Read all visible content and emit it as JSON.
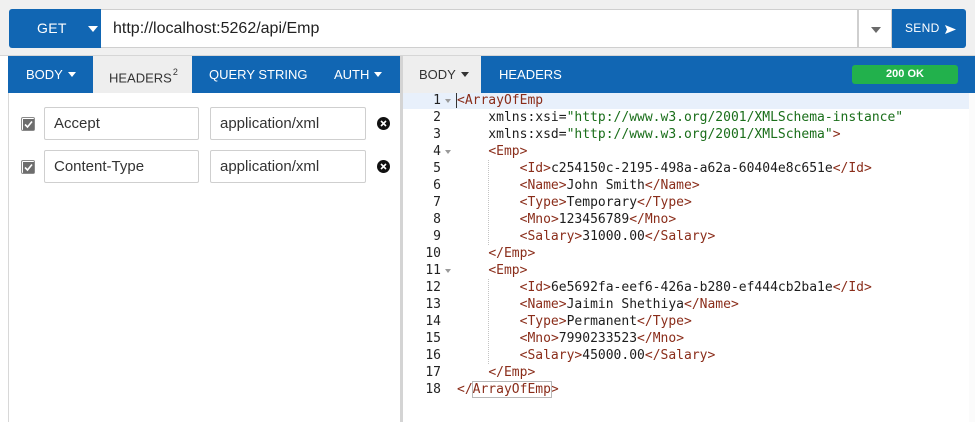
{
  "request": {
    "method": "GET",
    "url": "http://localhost:5262/api/Emp",
    "send_label": "SEND"
  },
  "request_tabs": [
    {
      "label": "BODY",
      "has_caret": true
    },
    {
      "label": "HEADERS",
      "badge": "2"
    },
    {
      "label": "QUERY STRING"
    },
    {
      "label": "AUTH",
      "has_caret": true
    }
  ],
  "headers": [
    {
      "enabled": true,
      "key": "Accept",
      "value": "application/xml"
    },
    {
      "enabled": true,
      "key": "Content-Type",
      "value": "application/xml"
    }
  ],
  "response_tabs": [
    {
      "label": "BODY",
      "has_caret": true
    },
    {
      "label": "HEADERS"
    }
  ],
  "response": {
    "status": "200 OK",
    "status_color": "#22b14c",
    "lines": [
      {
        "n": "1",
        "text": "<ArrayOfEmp"
      },
      {
        "n": "2",
        "text": "    xmlns:xsi=\"http://www.w3.org/2001/XMLSchema-instance\""
      },
      {
        "n": "3",
        "text": "    xmlns:xsd=\"http://www.w3.org/2001/XMLSchema\">"
      },
      {
        "n": "4",
        "text": "    <Emp>"
      },
      {
        "n": "5",
        "text": "        <Id>c254150c-2195-498a-a62a-60404e8c651e</Id>"
      },
      {
        "n": "6",
        "text": "        <Name>John Smith</Name>"
      },
      {
        "n": "7",
        "text": "        <Type>Temporary</Type>"
      },
      {
        "n": "8",
        "text": "        <Mno>123456789</Mno>"
      },
      {
        "n": "9",
        "text": "        <Salary>31000.00</Salary>"
      },
      {
        "n": "10",
        "text": "    </Emp>"
      },
      {
        "n": "11",
        "text": "    <Emp>"
      },
      {
        "n": "12",
        "text": "        <Id>6e5692fa-eef6-426a-b280-ef444cb2ba1e</Id>"
      },
      {
        "n": "13",
        "text": "        <Name>Jaimin Shethiya</Name>"
      },
      {
        "n": "14",
        "text": "        <Type>Permanent</Type>"
      },
      {
        "n": "15",
        "text": "        <Mno>7990233523</Mno>"
      },
      {
        "n": "16",
        "text": "        <Salary>45000.00</Salary>"
      },
      {
        "n": "17",
        "text": "    </Emp>"
      },
      {
        "n": "18",
        "text": "</ArrayOfEmp>"
      }
    ]
  },
  "theme": {
    "accent": "#1166b3",
    "tab_active_bg": "#eeeeee"
  },
  "icons": {
    "send": "send-arrow-icon",
    "remove": "remove-circle-icon",
    "check": "checkmark-icon",
    "fold": "fold-caret-icon"
  }
}
